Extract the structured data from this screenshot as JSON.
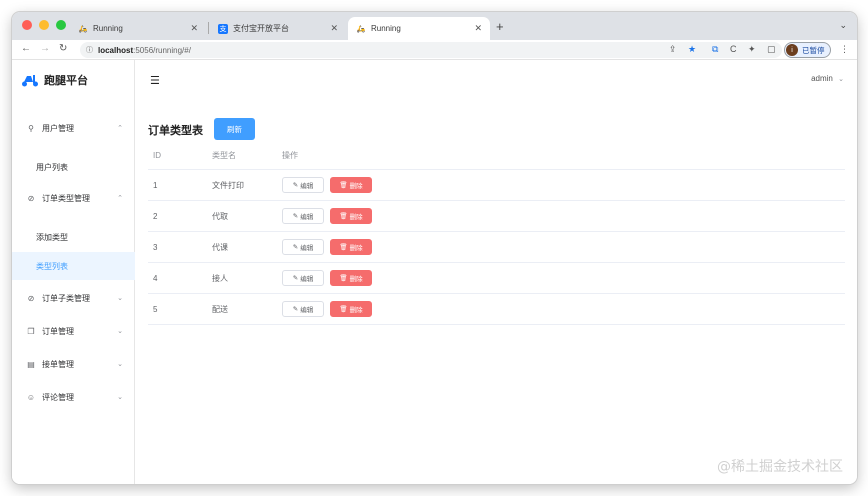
{
  "browser": {
    "tabs": [
      {
        "title": "Running",
        "active": false
      },
      {
        "title": "支付宝开放平台",
        "active": false
      },
      {
        "title": "Running",
        "active": true
      }
    ],
    "url_host": "localhost",
    "url_path": ":5056/running/#/",
    "profile_label": "已暂停",
    "profile_initial": "i"
  },
  "sidebar": {
    "brand": "跑腿平台",
    "menus": [
      {
        "label": "用户管理",
        "icon": "user-icon",
        "expanded": true,
        "children": [
          "用户列表"
        ]
      },
      {
        "label": "订单类型管理",
        "icon": "paperclip-icon",
        "expanded": true,
        "children": [
          "添加类型",
          "类型列表"
        ]
      },
      {
        "label": "订单子类管理",
        "icon": "paperclip-icon",
        "expanded": false
      },
      {
        "label": "订单管理",
        "icon": "copy-icon",
        "expanded": false
      },
      {
        "label": "接单管理",
        "icon": "document-icon",
        "expanded": false
      },
      {
        "label": "评论管理",
        "icon": "smile-icon",
        "expanded": false
      }
    ],
    "active_item": "类型列表"
  },
  "header": {
    "user": "admin"
  },
  "page": {
    "title": "订单类型表",
    "refresh_label": "刷新",
    "columns": [
      "ID",
      "类型名",
      "操作"
    ],
    "rows": [
      {
        "id": "1",
        "name": "文件打印"
      },
      {
        "id": "2",
        "name": "代取"
      },
      {
        "id": "3",
        "name": "代课"
      },
      {
        "id": "4",
        "name": "接人"
      },
      {
        "id": "5",
        "name": "配送"
      }
    ],
    "edit_label": "编辑",
    "delete_label": "删除"
  },
  "watermark": "@稀土掘金技术社区",
  "colors": {
    "primary": "#409eff",
    "danger": "#f56c6c",
    "active_bg": "#ecf5ff"
  }
}
